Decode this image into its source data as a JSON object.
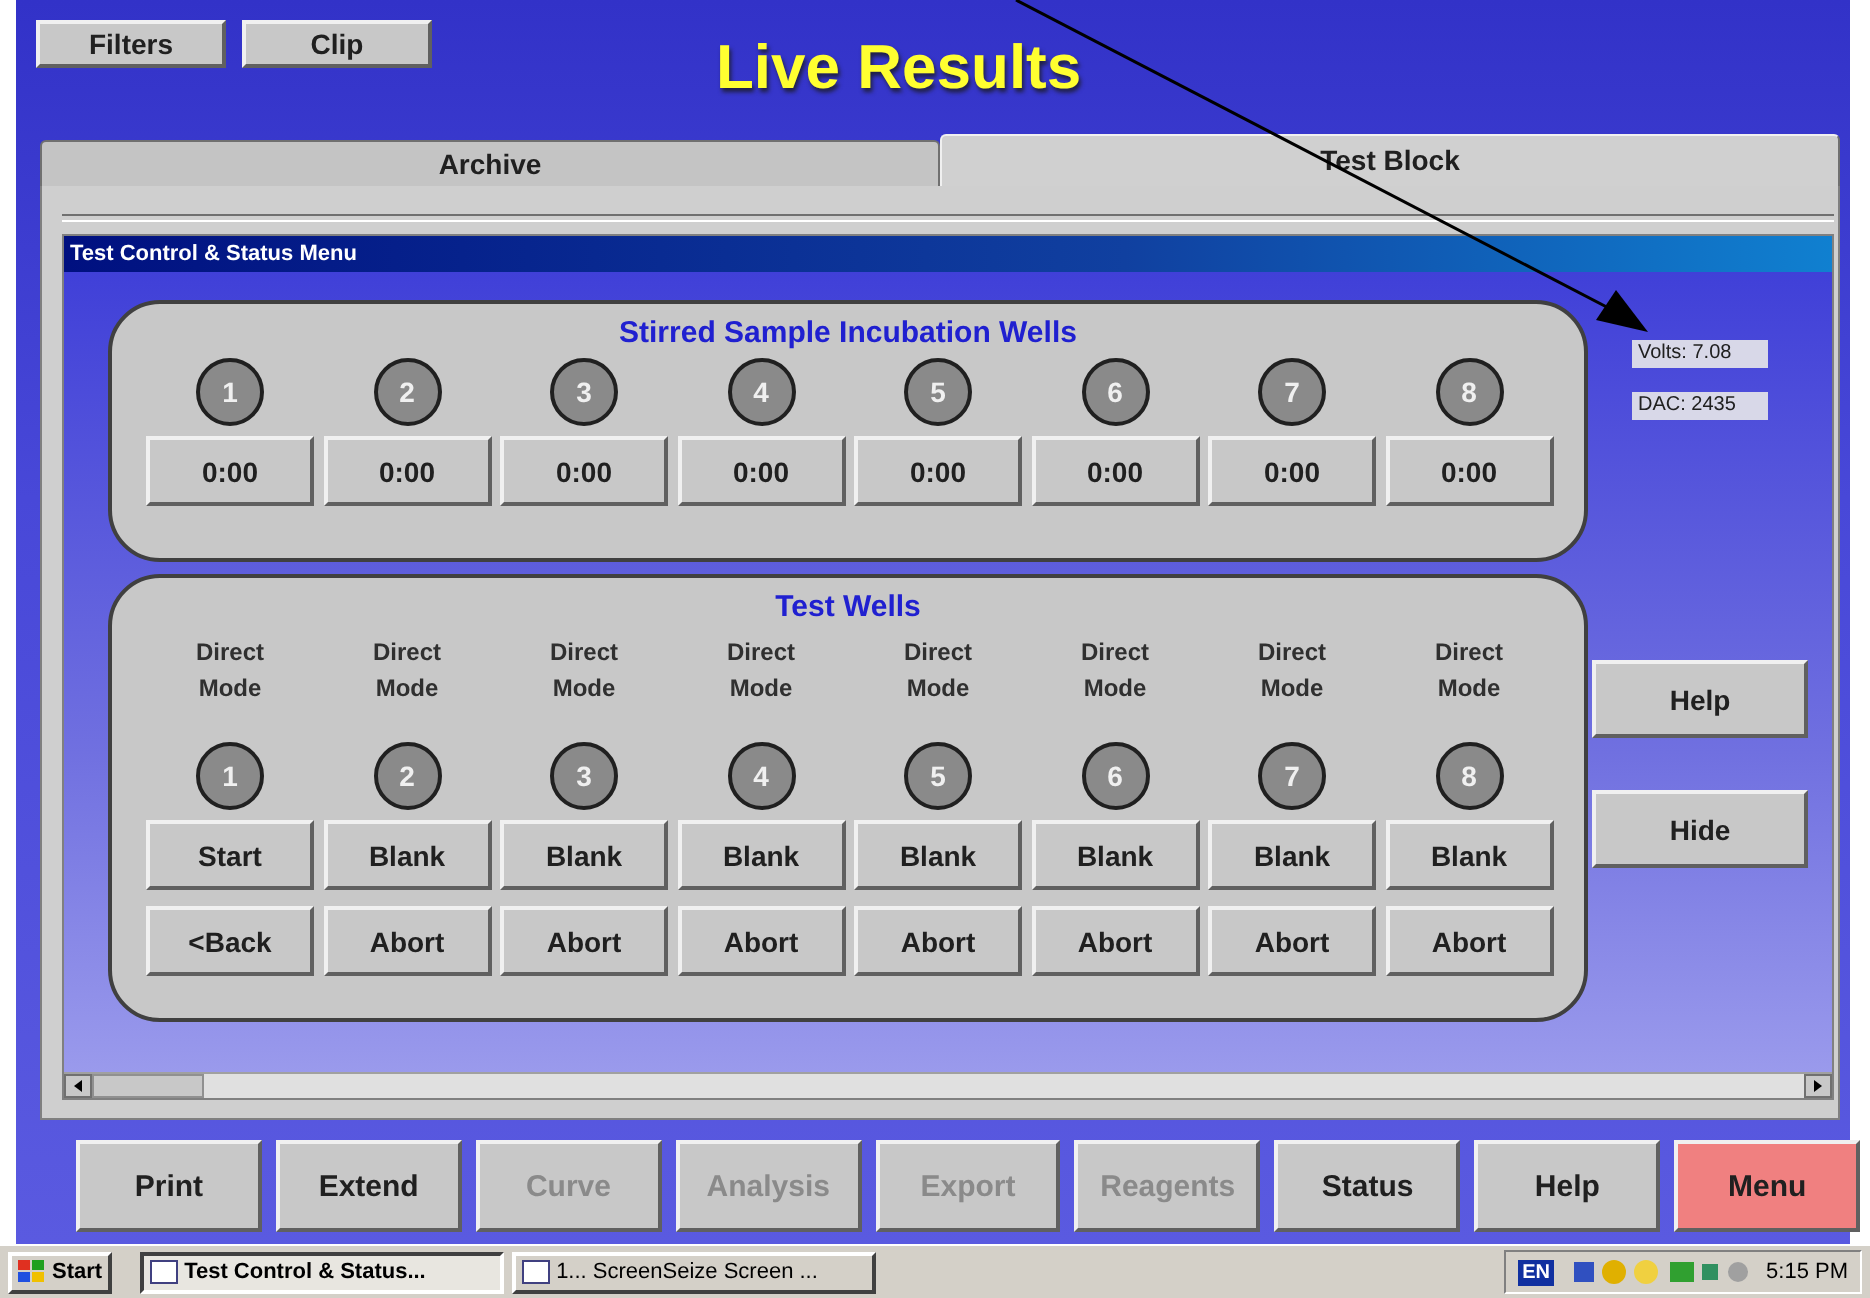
{
  "top_buttons": [
    {
      "label": "Filters"
    },
    {
      "label": "Clip"
    }
  ],
  "title": "Live Results",
  "tabs": [
    {
      "label": "Archive",
      "selected": false
    },
    {
      "label": "Test Block",
      "selected": true
    }
  ],
  "dialog": {
    "title": "Test Control & Status Menu",
    "incubation": {
      "title": "Stirred Sample Incubation Wells",
      "wells": [
        {
          "number": "1",
          "time": "0:00"
        },
        {
          "number": "2",
          "time": "0:00"
        },
        {
          "number": "3",
          "time": "0:00"
        },
        {
          "number": "4",
          "time": "0:00"
        },
        {
          "number": "5",
          "time": "0:00"
        },
        {
          "number": "6",
          "time": "0:00"
        },
        {
          "number": "7",
          "time": "0:00"
        },
        {
          "number": "8",
          "time": "0:00"
        }
      ]
    },
    "test_wells": {
      "title": "Test Wells",
      "wells": [
        {
          "mode": "Direct Mode",
          "number": "1",
          "action": "Start",
          "secondary": "<Back"
        },
        {
          "mode": "Direct Mode",
          "number": "2",
          "action": "Blank",
          "secondary": "Abort"
        },
        {
          "mode": "Direct Mode",
          "number": "3",
          "action": "Blank",
          "secondary": "Abort"
        },
        {
          "mode": "Direct Mode",
          "number": "4",
          "action": "Blank",
          "secondary": "Abort"
        },
        {
          "mode": "Direct Mode",
          "number": "5",
          "action": "Blank",
          "secondary": "Abort"
        },
        {
          "mode": "Direct Mode",
          "number": "6",
          "action": "Blank",
          "secondary": "Abort"
        },
        {
          "mode": "Direct Mode",
          "number": "7",
          "action": "Blank",
          "secondary": "Abort"
        },
        {
          "mode": "Direct Mode",
          "number": "8",
          "action": "Blank",
          "secondary": "Abort"
        }
      ]
    },
    "readouts": [
      {
        "text": "Volts: 7.08"
      },
      {
        "text": "DAC: 2435"
      }
    ],
    "side_buttons": [
      {
        "label": "Help"
      },
      {
        "label": "Hide"
      }
    ]
  },
  "toolbar": [
    {
      "label": "Print",
      "disabled": false,
      "highlighted": false
    },
    {
      "label": "Extend",
      "disabled": false,
      "highlighted": false
    },
    {
      "label": "Curve",
      "disabled": true,
      "highlighted": false
    },
    {
      "label": "Analysis",
      "disabled": true,
      "highlighted": false
    },
    {
      "label": "Export",
      "disabled": true,
      "highlighted": false
    },
    {
      "label": "Reagents",
      "disabled": true,
      "highlighted": false
    },
    {
      "label": "Status",
      "disabled": false,
      "highlighted": false
    },
    {
      "label": "Help",
      "disabled": false,
      "highlighted": false
    },
    {
      "label": "Menu",
      "disabled": false,
      "highlighted": true
    }
  ],
  "taskbar": {
    "start": "Start",
    "tasks": [
      {
        "label": "Test Control & Status...",
        "selected": true
      },
      {
        "label": "1... ScreenSeize Screen ...",
        "selected": false
      }
    ],
    "language": "EN",
    "clock": "5:15 PM"
  }
}
